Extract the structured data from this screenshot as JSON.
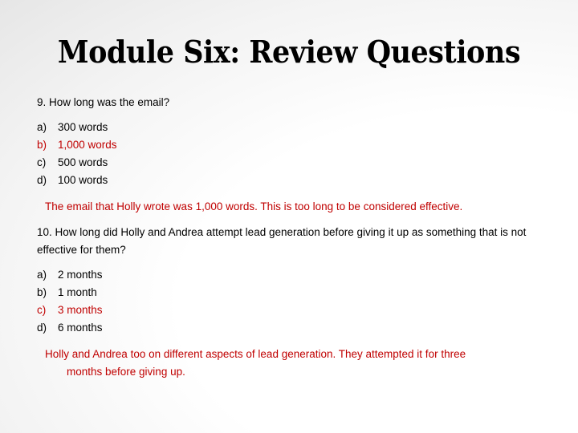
{
  "slide": {
    "title": "Module Six: Review Questions",
    "questions": [
      {
        "number": "9.",
        "text": "How long was the email?",
        "options": [
          {
            "letter": "a)",
            "text": "300 words",
            "correct": false
          },
          {
            "letter": "b)",
            "text": "1,000 words",
            "correct": true
          },
          {
            "letter": "c)",
            "text": "500 words",
            "correct": false
          },
          {
            "letter": "d)",
            "text": "100 words",
            "correct": false
          }
        ],
        "explanation": "The email that Holly wrote was 1,000 words. This is too long to be considered effective."
      },
      {
        "number": "10.",
        "text": "How long did Holly and Andrea attempt lead generation before giving it up as something that is not effective for them?",
        "options": [
          {
            "letter": "a)",
            "text": "2 months",
            "correct": false
          },
          {
            "letter": "b)",
            "text": "1 month",
            "correct": false
          },
          {
            "letter": "c)",
            "text": "3 months",
            "correct": true
          },
          {
            "letter": "d)",
            "text": "6 months",
            "correct": false
          }
        ],
        "explanation_line1": "Holly and Andrea too on different aspects of lead generation. They attempted it for three",
        "explanation_line2": "months before giving up."
      }
    ]
  },
  "colors": {
    "correct_answer": "#c00000",
    "text": "#000000"
  }
}
